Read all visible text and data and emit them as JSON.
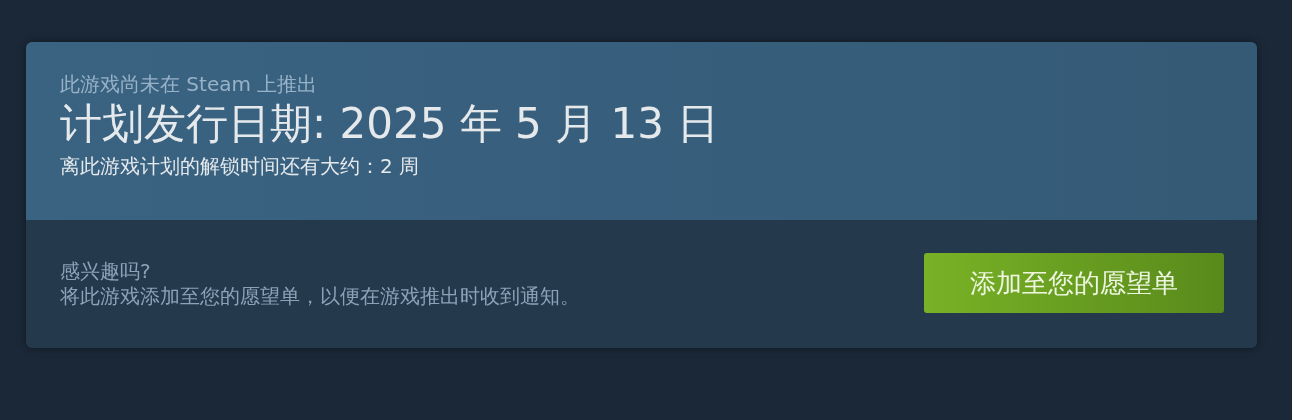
{
  "release": {
    "notice": "此游戏尚未在 Steam 上推出",
    "date_title": "计划发行日期: 2025 年 5 月 13 日",
    "countdown": "离此游戏计划的解锁时间还有大约：2 周"
  },
  "wishlist": {
    "question": "感兴趣吗?",
    "description": "将此游戏添加至您的愿望单，以便在游戏推出时收到通知。",
    "button": "添加至您的愿望单"
  }
}
